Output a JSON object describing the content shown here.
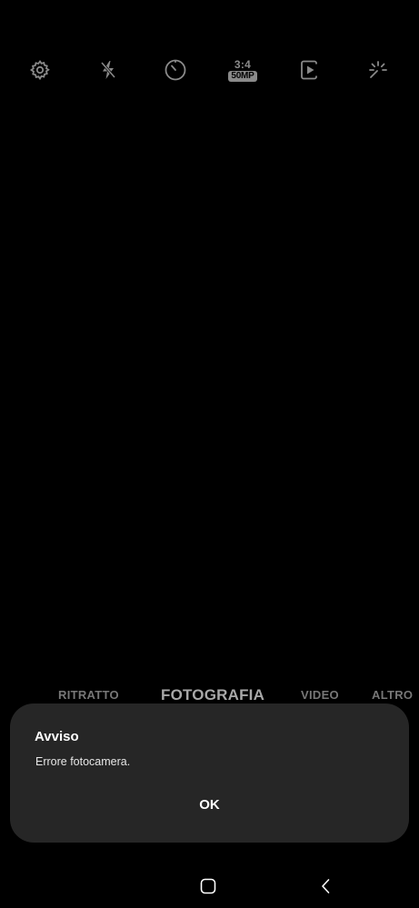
{
  "toolbar": {
    "icons": [
      "settings-icon",
      "flash-off-icon",
      "timer-icon",
      "aspect-ratio-icon",
      "motion-photo-icon",
      "effects-icon"
    ],
    "ratio_label": "3:4",
    "resolution_label": "50MP",
    "icon_color": "#8a8a8a"
  },
  "modes": {
    "portrait": "RITRATTO",
    "photo": "FOTOGRAFIA",
    "video": "VIDEO",
    "more": "ALTRO",
    "active": "FOTOGRAFIA"
  },
  "dialog": {
    "title": "Avviso",
    "message": "Errore fotocamera.",
    "ok_label": "OK",
    "background": "#262626"
  },
  "nav": {
    "icons": [
      "home-icon",
      "back-icon"
    ]
  }
}
